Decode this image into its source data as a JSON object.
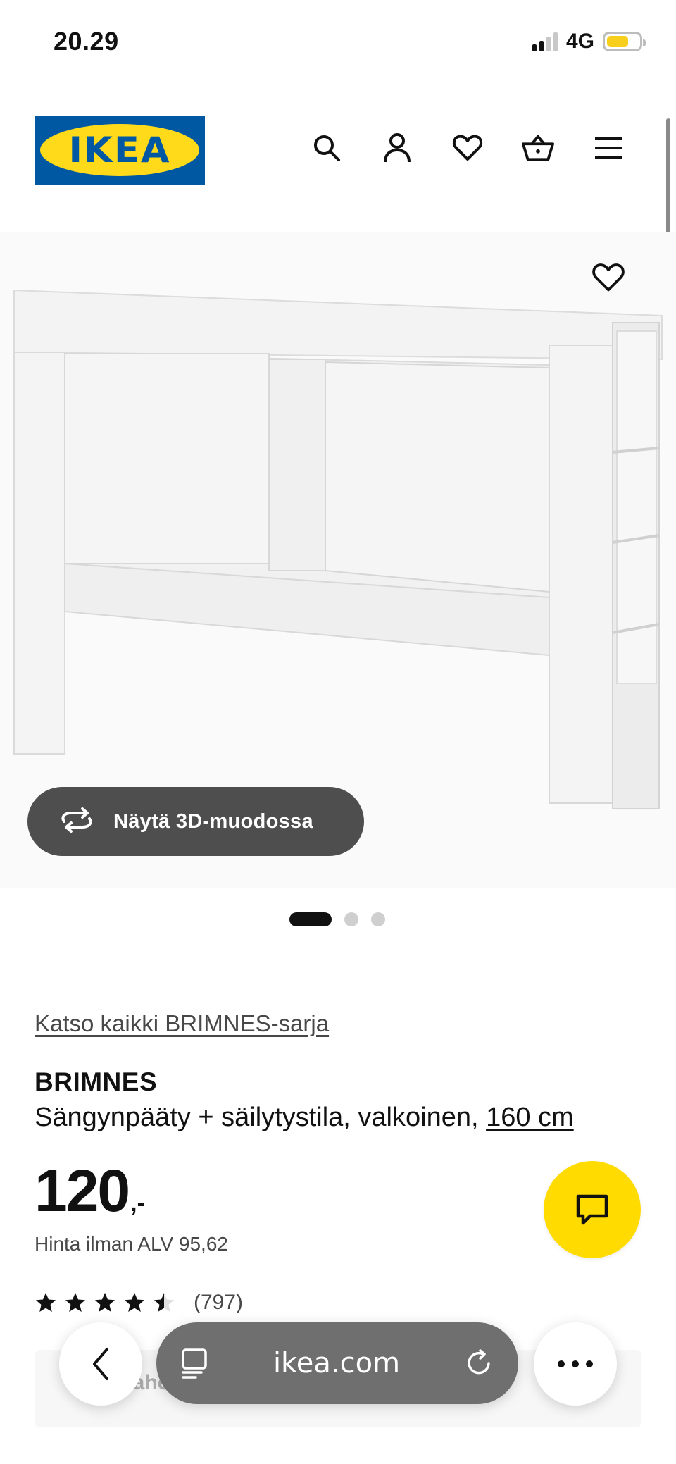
{
  "status_bar": {
    "time": "20.29",
    "network": "4G",
    "battery_color": "#f7cf1c"
  },
  "header": {
    "logo_text": "IKEA",
    "brand_colors": {
      "blue": "#0058a3",
      "yellow": "#ffda1a"
    },
    "icons": [
      "search-icon",
      "account-icon",
      "heart-icon",
      "shopping-basket-icon",
      "menu-icon"
    ]
  },
  "hero": {
    "view_3d_label": "Näytä 3D-muodossa",
    "carousel_total": 3,
    "carousel_active": 1
  },
  "product": {
    "series_link": "Katso kaikki BRIMNES-sarja",
    "name": "BRIMNES",
    "description": "Sängynpääty + säilytystila, valkoinen, ",
    "size_link": "160 cm",
    "price_integer": "120",
    "price_suffix": ",-",
    "vat_text": "Hinta ilman ALV 95,62",
    "rating_value": 4.5,
    "rating_count": "(797)"
  },
  "faded_row": {
    "text": "Kaho"
  },
  "browser_toolbar": {
    "url": "ikea.com"
  },
  "colors": {
    "chat_button": "#ffdb00",
    "button_dark": "#4e4e4e"
  }
}
